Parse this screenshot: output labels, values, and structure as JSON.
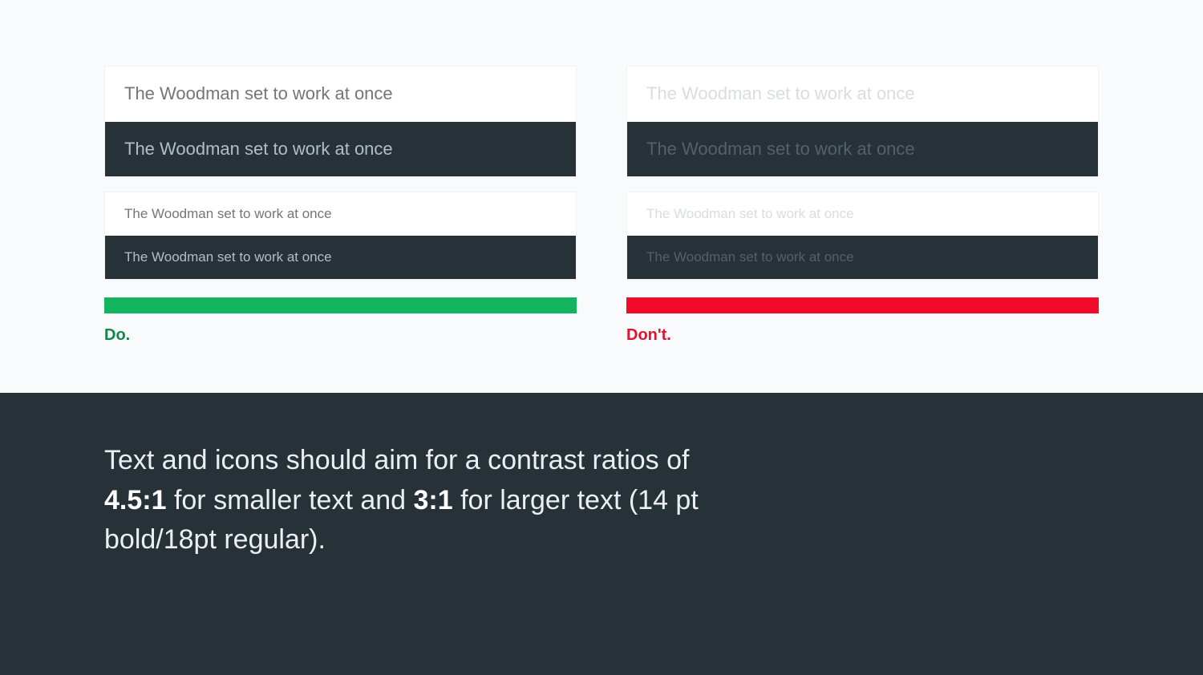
{
  "sample_text": "The Woodman set to work at once",
  "do": {
    "label": "Do."
  },
  "dont": {
    "label": "Don't."
  },
  "footer": {
    "part1": "Text and icons should aim for a contrast ratios of ",
    "bold1": "4.5:1",
    "part2": " for smaller text and ",
    "bold2": "3:1",
    "part3": " for larger text (14 pt bold/18pt regular)."
  },
  "colors": {
    "green_bar": "#12b55e",
    "red_bar": "#f30a2b",
    "dark_surface": "#263238"
  }
}
